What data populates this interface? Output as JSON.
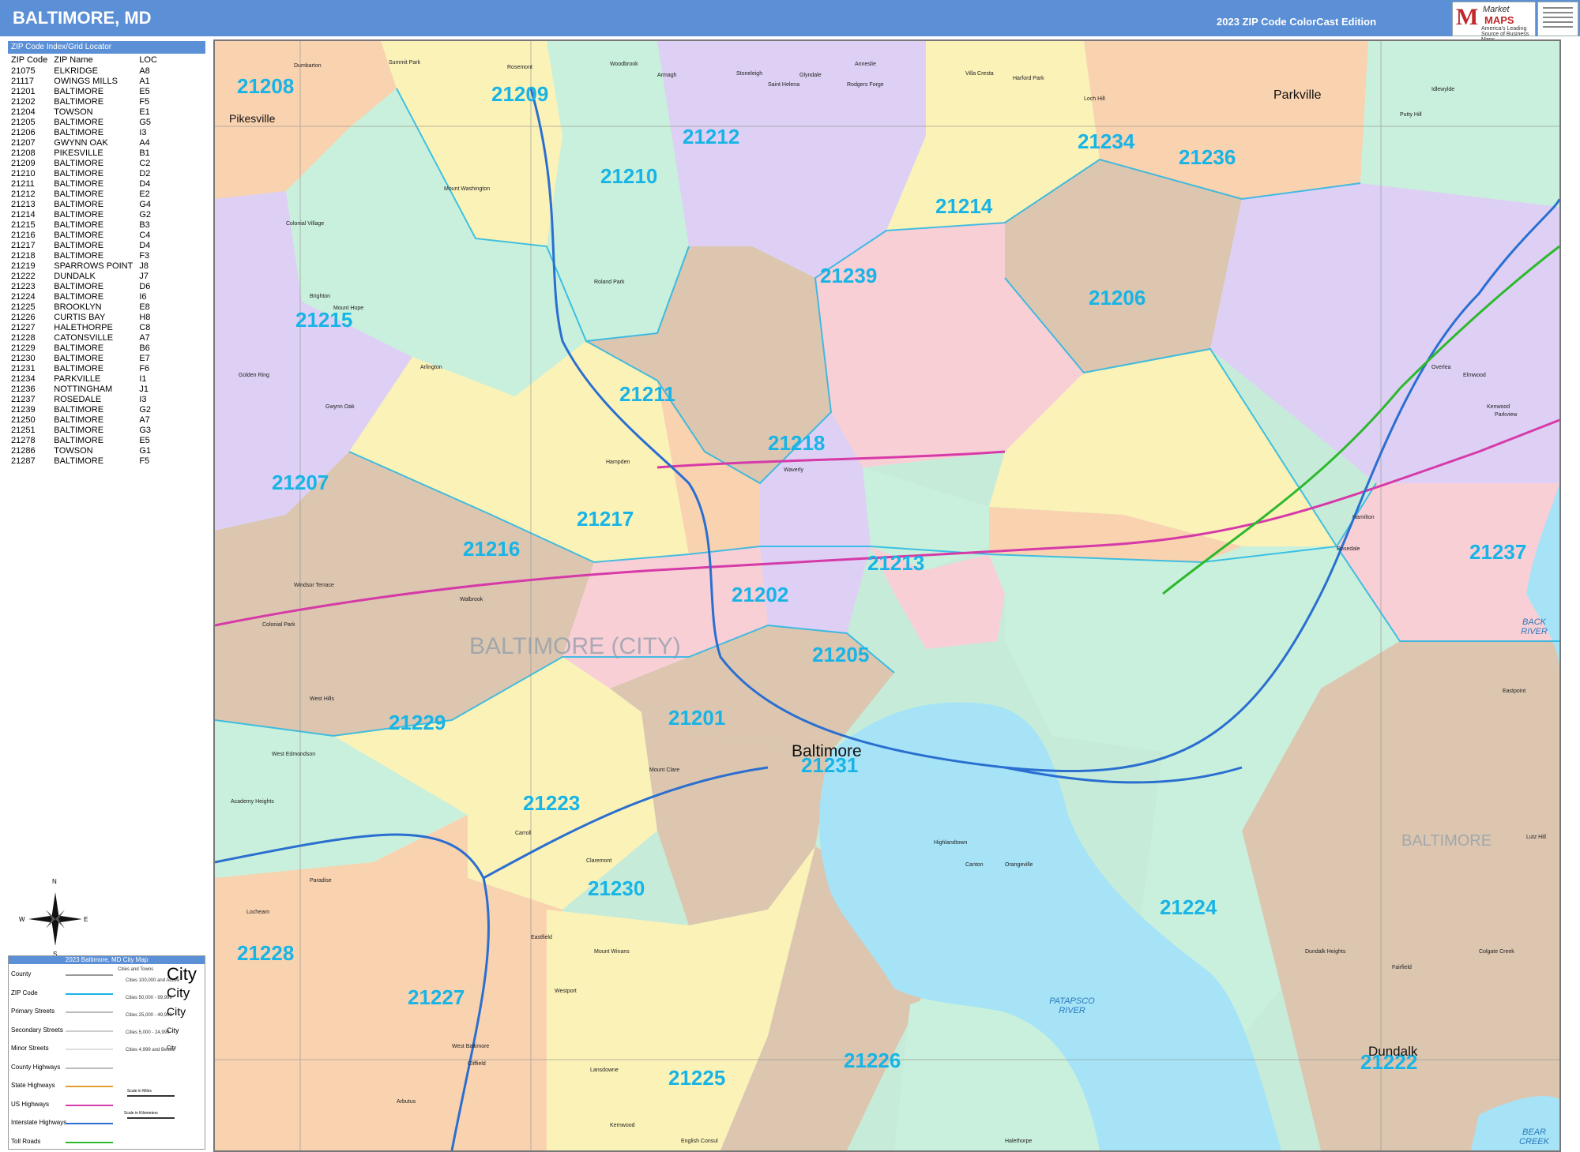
{
  "header": {
    "title": "BALTIMORE, MD",
    "edition": "2023 ZIP Code ColorCast Edition",
    "logo_market": "Market",
    "logo_maps": "MAPS",
    "logo_tagline": "America's Leading Source of Business Maps"
  },
  "zip_index": {
    "heading": "ZIP Code Index/Grid Locator",
    "columns": [
      "ZIP Code",
      "ZIP Name",
      "LOC"
    ],
    "rows": [
      [
        "21075",
        "ELKRIDGE",
        "A8"
      ],
      [
        "21117",
        "OWINGS MILLS",
        "A1"
      ],
      [
        "21201",
        "BALTIMORE",
        "E5"
      ],
      [
        "21202",
        "BALTIMORE",
        "F5"
      ],
      [
        "21204",
        "TOWSON",
        "E1"
      ],
      [
        "21205",
        "BALTIMORE",
        "G5"
      ],
      [
        "21206",
        "BALTIMORE",
        "I3"
      ],
      [
        "21207",
        "GWYNN OAK",
        "A4"
      ],
      [
        "21208",
        "PIKESVILLE",
        "B1"
      ],
      [
        "21209",
        "BALTIMORE",
        "C2"
      ],
      [
        "21210",
        "BALTIMORE",
        "D2"
      ],
      [
        "21211",
        "BALTIMORE",
        "D4"
      ],
      [
        "21212",
        "BALTIMORE",
        "E2"
      ],
      [
        "21213",
        "BALTIMORE",
        "G4"
      ],
      [
        "21214",
        "BALTIMORE",
        "G2"
      ],
      [
        "21215",
        "BALTIMORE",
        "B3"
      ],
      [
        "21216",
        "BALTIMORE",
        "C4"
      ],
      [
        "21217",
        "BALTIMORE",
        "D4"
      ],
      [
        "21218",
        "BALTIMORE",
        "F3"
      ],
      [
        "21219",
        "SPARROWS POINT",
        "J8"
      ],
      [
        "21222",
        "DUNDALK",
        "J7"
      ],
      [
        "21223",
        "BALTIMORE",
        "D6"
      ],
      [
        "21224",
        "BALTIMORE",
        "I6"
      ],
      [
        "21225",
        "BROOKLYN",
        "E8"
      ],
      [
        "21226",
        "CURTIS BAY",
        "H8"
      ],
      [
        "21227",
        "HALETHORPE",
        "C8"
      ],
      [
        "21228",
        "CATONSVILLE",
        "A7"
      ],
      [
        "21229",
        "BALTIMORE",
        "B6"
      ],
      [
        "21230",
        "BALTIMORE",
        "E7"
      ],
      [
        "21231",
        "BALTIMORE",
        "F6"
      ],
      [
        "21234",
        "PARKVILLE",
        "I1"
      ],
      [
        "21236",
        "NOTTINGHAM",
        "J1"
      ],
      [
        "21237",
        "ROSEDALE",
        "I3"
      ],
      [
        "21239",
        "BALTIMORE",
        "G2"
      ],
      [
        "21250",
        "BALTIMORE",
        "A7"
      ],
      [
        "21251",
        "BALTIMORE",
        "G3"
      ],
      [
        "21278",
        "BALTIMORE",
        "E5"
      ],
      [
        "21286",
        "TOWSON",
        "G1"
      ],
      [
        "21287",
        "BALTIMORE",
        "F5"
      ]
    ]
  },
  "map": {
    "zip_labels": [
      {
        "code": "21208"
      },
      {
        "code": "21209"
      },
      {
        "code": "21212"
      },
      {
        "code": "21210"
      },
      {
        "code": "21234"
      },
      {
        "code": "21236"
      },
      {
        "code": "21214"
      },
      {
        "code": "21239"
      },
      {
        "code": "21206"
      },
      {
        "code": "21215"
      },
      {
        "code": "21211"
      },
      {
        "code": "21218"
      },
      {
        "code": "21207"
      },
      {
        "code": "21217"
      },
      {
        "code": "21216"
      },
      {
        "code": "21213"
      },
      {
        "code": "21237"
      },
      {
        "code": "21202"
      },
      {
        "code": "21205"
      },
      {
        "code": "21201"
      },
      {
        "code": "21229"
      },
      {
        "code": "21231"
      },
      {
        "code": "21223"
      },
      {
        "code": "21230"
      },
      {
        "code": "21224"
      },
      {
        "code": "21228"
      },
      {
        "code": "21227"
      },
      {
        "code": "21225"
      },
      {
        "code": "21226"
      },
      {
        "code": "21222"
      }
    ],
    "city_labels": [
      "Pikesville",
      "Parkville",
      "Baltimore",
      "Dundalk"
    ],
    "area_labels": [
      "BALTIMORE (CITY)",
      "BALTIMORE"
    ],
    "water_labels": [
      "PATAPSCO RIVER",
      "BACK RIVER",
      "BEAR CREEK"
    ],
    "place_labels": [
      "Dumbarton",
      "Summit Park",
      "Woodbrook",
      "Armagh",
      "Stoneleigh",
      "Glyndale",
      "Villa Cresta",
      "Harford Park",
      "Mount Washington",
      "Colonial Village",
      "Brighton",
      "Mount Hope",
      "Roland Park",
      "Arlington",
      "Gwynn Oak",
      "Hampden",
      "Waverly",
      "Windsor Terrace",
      "Walbrook",
      "Colonial Park",
      "West Hills",
      "West Edmondson",
      "Academy Heights",
      "Carroll",
      "Claremont",
      "Mount Clare",
      "Highlandtown",
      "Canton",
      "Orangeville",
      "Rosedale",
      "Hamilton",
      "Elmwood",
      "Kenwood",
      "Overlea",
      "Lutz Hill",
      "Eastpoint",
      "Dundalk Heights",
      "Colgate Creek",
      "Eastfield",
      "Mount Winans",
      "Westport",
      "West Baltimore",
      "Lansdowne",
      "Arbutus",
      "Cliffield",
      "Halethorpe",
      "Fairfield",
      "Saint Helena",
      "Rodgers Forge",
      "Anneslie",
      "Loch Hill",
      "Idlewylde",
      "Putty Hill",
      "Parkview",
      "Golden Ring",
      "Lochearn",
      "Paradise",
      "Kernwood",
      "English Consul",
      "Rosemont"
    ]
  },
  "legend": {
    "title": "2023 Baltimore, MD City Map",
    "rows": [
      {
        "label": "County",
        "color": "#999999"
      },
      {
        "label": "ZIP Code",
        "color": "#18b4e6"
      },
      {
        "label": "Primary Streets",
        "color": "#bbbbbb"
      },
      {
        "label": "Secondary Streets",
        "color": "#cccccc"
      },
      {
        "label": "Minor Streets",
        "color": "#dddddd"
      },
      {
        "label": "County Highways",
        "color": "#bbbbbb"
      },
      {
        "label": "State Highways",
        "color": "#e0a030"
      },
      {
        "label": "US Highways",
        "color": "#d63aa8"
      },
      {
        "label": "Interstate Highways",
        "color": "#2a6fd0"
      },
      {
        "label": "Toll Roads",
        "color": "#2eb82e"
      }
    ],
    "city_classes": [
      {
        "range": "Cities 100,000 and Above",
        "name": "City"
      },
      {
        "range": "Cities 50,000 - 99,999",
        "name": "City"
      },
      {
        "range": "Cities 25,000 - 49,999",
        "name": "City"
      },
      {
        "range": "Cities 5,000 - 24,999",
        "name": "City"
      },
      {
        "range": "Cities 4,999 and Below",
        "name": "City"
      }
    ],
    "cities_towns_heading": "Cities and Towns",
    "scale_miles": "Scale in Miles",
    "scale_km": "Scale in Kilometers"
  },
  "compass": {
    "n": "N",
    "s": "S",
    "e": "E",
    "w": "W"
  },
  "colors": {
    "header": "#5b8fd6",
    "zip_label": "#18b4e6",
    "water": "#a6e3f7"
  }
}
